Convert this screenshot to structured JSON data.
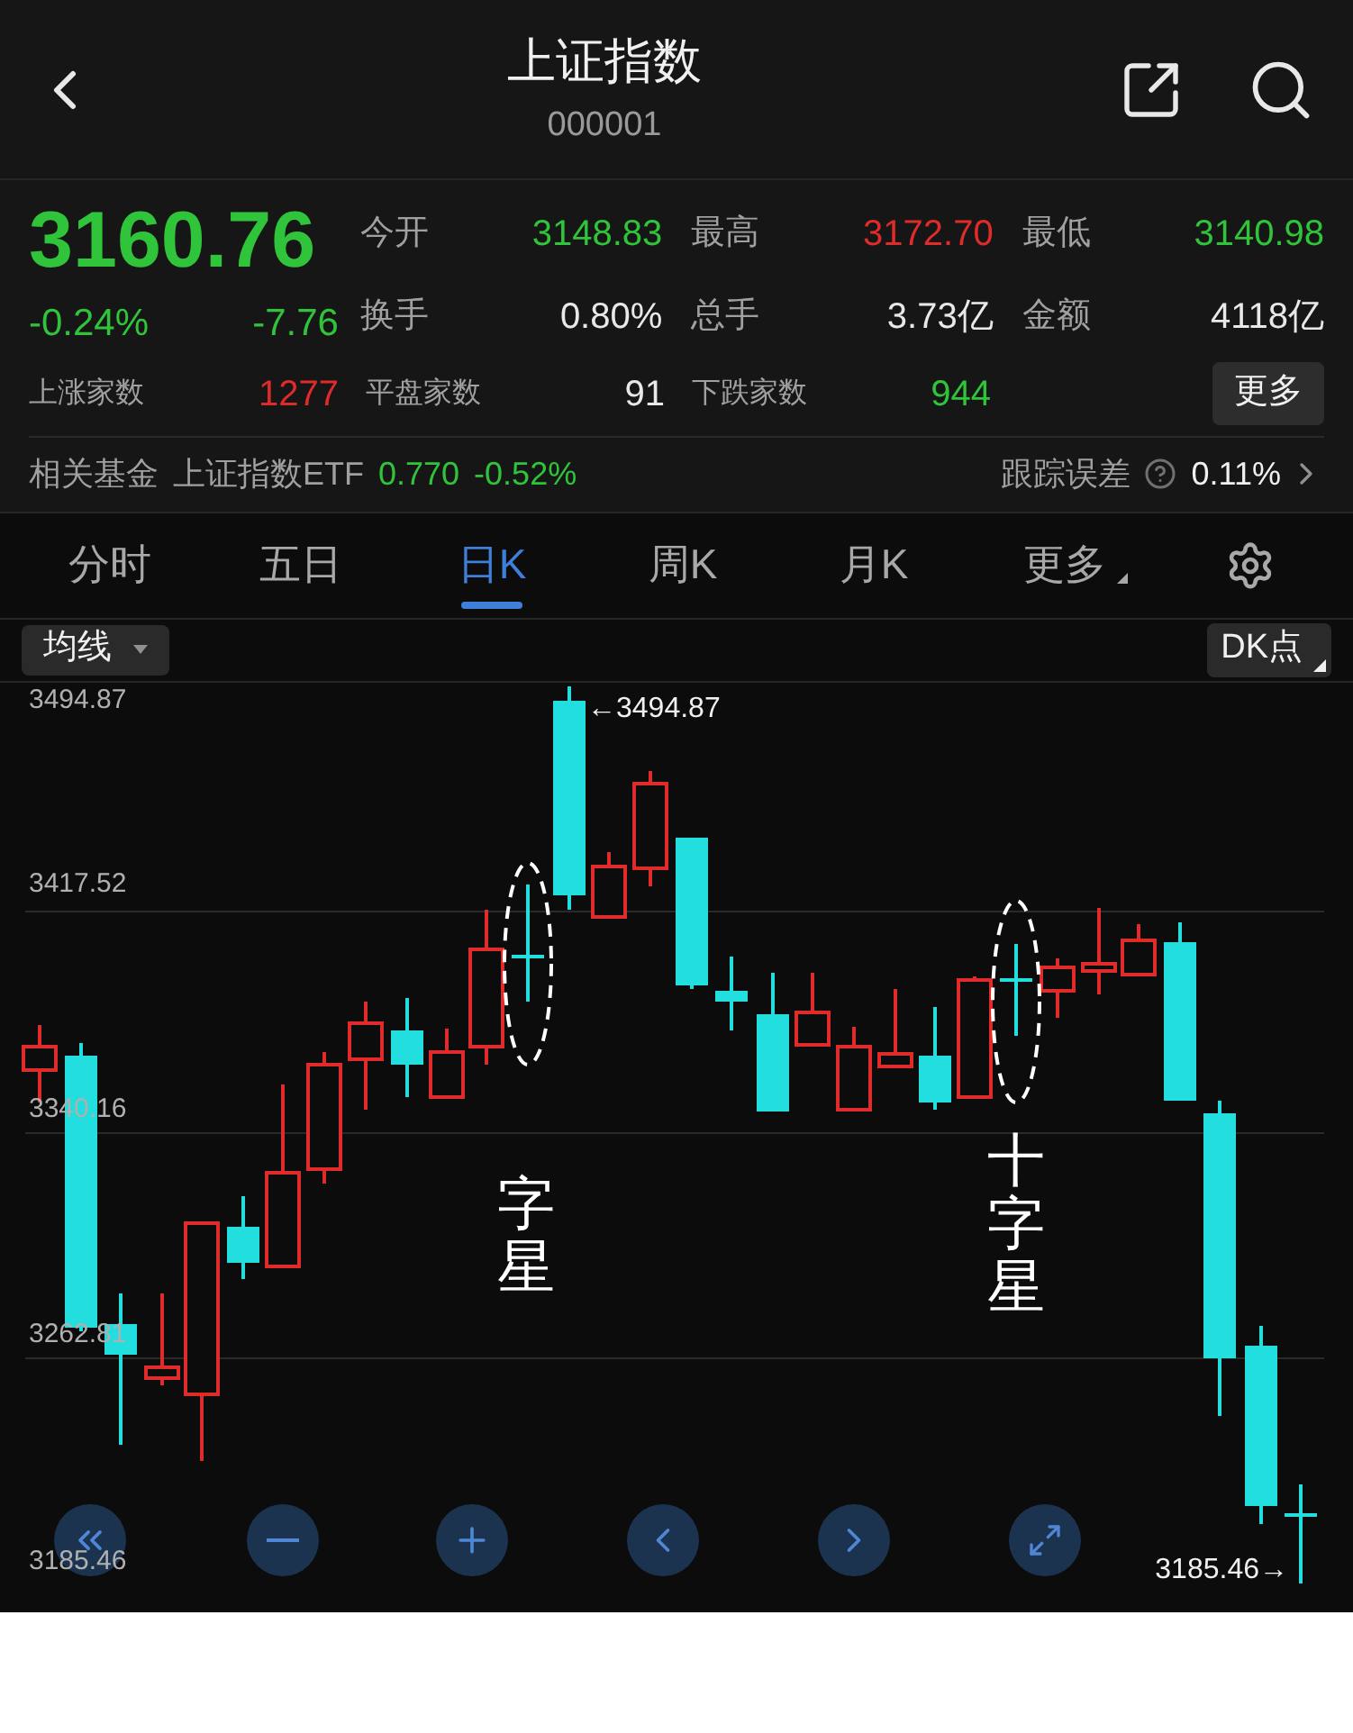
{
  "header": {
    "title": "上证指数",
    "code": "000001"
  },
  "quote": {
    "price": "3160.76",
    "change_pct": "-0.24%",
    "change": "-7.76",
    "color": "#2fc43a"
  },
  "stats": [
    {
      "label": "今开",
      "value": "3148.83",
      "color": "#2fc43a"
    },
    {
      "label": "最高",
      "value": "3172.70",
      "color": "#e02b2b"
    },
    {
      "label": "最低",
      "value": "3140.98",
      "color": "#2fc43a"
    },
    {
      "label": "换手",
      "value": "0.80%",
      "color": "#e8e8e8"
    },
    {
      "label": "总手",
      "value": "3.73亿",
      "color": "#e8e8e8"
    },
    {
      "label": "金额",
      "value": "4118亿",
      "color": "#e8e8e8"
    }
  ],
  "breadth": [
    {
      "label": "上涨家数",
      "value": "1277",
      "color": "#e02b2b"
    },
    {
      "label": "平盘家数",
      "value": "91",
      "color": "#e8e8e8"
    },
    {
      "label": "下跌家数",
      "value": "944",
      "color": "#2fc43a"
    }
  ],
  "more_button": "更多",
  "fund": {
    "label": "相关基金",
    "name": "上证指数ETF",
    "price": "0.770",
    "change": "-0.52%",
    "color": "#2fc43a",
    "tracking_label": "跟踪误差",
    "tracking_value": "0.11%"
  },
  "tabs": [
    {
      "label": "分时",
      "selected": false,
      "kind": "tab"
    },
    {
      "label": "五日",
      "selected": false,
      "kind": "tab"
    },
    {
      "label": "日K",
      "selected": true,
      "kind": "tab"
    },
    {
      "label": "周K",
      "selected": false,
      "kind": "tab"
    },
    {
      "label": "月K",
      "selected": false,
      "kind": "tab"
    },
    {
      "label": "更多",
      "selected": false,
      "kind": "dropdown"
    }
  ],
  "chart": {
    "indicator_menu": "均线",
    "dk_button": "DK点",
    "y_labels": [
      "3494.87",
      "3417.52",
      "3340.16",
      "3262.81",
      "3185.46"
    ],
    "max_label": "←3494.87",
    "min_label": "3185.46→",
    "annotations": [
      "字星",
      "十字星"
    ]
  }
}
